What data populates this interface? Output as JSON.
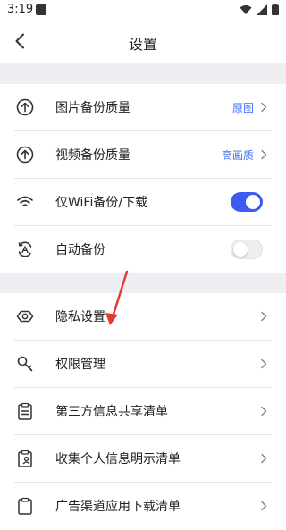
{
  "status_bar": {
    "time": "3:19"
  },
  "header": {
    "title": "设置"
  },
  "settings_group_1": [
    {
      "label": "图片备份质量",
      "value": "原图",
      "icon": "upload-circle-icon",
      "control": "chevron"
    },
    {
      "label": "视频备份质量",
      "value": "高画质",
      "icon": "upload-circle-icon",
      "control": "chevron"
    },
    {
      "label": "仅WiFi备份/下载",
      "value": "",
      "icon": "wifi-icon",
      "control": "toggle",
      "state": true
    },
    {
      "label": "自动备份",
      "value": "",
      "icon": "auto-backup-icon",
      "control": "toggle",
      "state": false
    }
  ],
  "settings_group_2": [
    {
      "label": "隐私设置",
      "icon": "privacy-eye-icon"
    },
    {
      "label": "权限管理",
      "icon": "key-icon"
    },
    {
      "label": "第三方信息共享清单",
      "icon": "clipboard-list-icon"
    },
    {
      "label": "收集个人信息明示清单",
      "icon": "clipboard-person-icon"
    },
    {
      "label": "广告渠道应用下载清单",
      "icon": "clipboard-icon"
    }
  ],
  "colors": {
    "accent": "#3d5af1",
    "value_text": "#3d6ef5",
    "band": "#efeff3",
    "annotation": "#e53935"
  }
}
